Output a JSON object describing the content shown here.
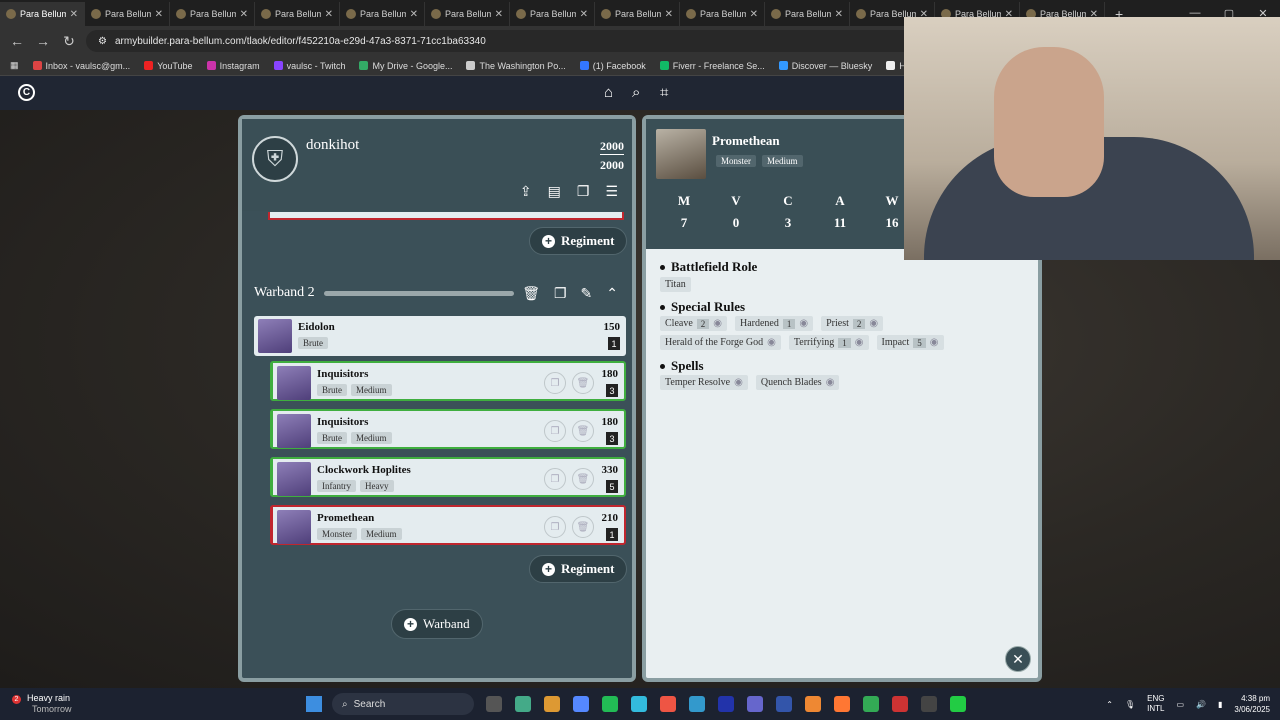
{
  "browser": {
    "tabs": [
      {
        "title": "Para Bellum",
        "active": true
      },
      {
        "title": "Para Bellum"
      },
      {
        "title": "Para Bellum"
      },
      {
        "title": "Para Bellum"
      },
      {
        "title": "Para Bellum"
      },
      {
        "title": "Para Bellum"
      },
      {
        "title": "Para Bellum"
      },
      {
        "title": "Para Bellum"
      },
      {
        "title": "Para Bellum"
      },
      {
        "title": "Para Bellum"
      },
      {
        "title": "Para Bellum"
      },
      {
        "title": "Para Bellum"
      },
      {
        "title": "Para Bellum"
      }
    ],
    "url": "armybuilder.para-bellum.com/tlaok/editor/f452210a-e29d-47a3-8371-71cc1ba63340",
    "bookmarks": [
      {
        "label": "Inbox - vaulsc@gm...",
        "color": "#d44"
      },
      {
        "label": "YouTube",
        "color": "#e22"
      },
      {
        "label": "Instagram",
        "color": "#c3a"
      },
      {
        "label": "vaulsc - Twitch",
        "color": "#84f"
      },
      {
        "label": "My Drive - Google...",
        "color": "#3a6"
      },
      {
        "label": "The Washington Po...",
        "color": "#ccc"
      },
      {
        "label": "(1) Facebook",
        "color": "#37f"
      },
      {
        "label": "Fiverr - Freelance Se...",
        "color": "#1b6"
      },
      {
        "label": "Discover — Bluesky",
        "color": "#39f"
      },
      {
        "label": "Home • Threads",
        "color": "#eee"
      }
    ]
  },
  "army": {
    "name": "donkihot",
    "points_used": "2000",
    "points_limit": "2000",
    "regiment_label": "Regiment",
    "warband_title": "Warband 2",
    "add_warband_label": "Warband",
    "units": [
      {
        "name": "Eidolon",
        "tags": [
          "Brute"
        ],
        "points": "150",
        "count": "1",
        "border": "none"
      },
      {
        "name": "Inquisitors",
        "tags": [
          "Brute",
          "Medium"
        ],
        "points": "180",
        "count": "3",
        "border": "green"
      },
      {
        "name": "Inquisitors",
        "tags": [
          "Brute",
          "Medium"
        ],
        "points": "180",
        "count": "3",
        "border": "green"
      },
      {
        "name": "Clockwork Hoplites",
        "tags": [
          "Infantry",
          "Heavy"
        ],
        "points": "330",
        "count": "5",
        "border": "green"
      },
      {
        "name": "Promethean",
        "tags": [
          "Monster",
          "Medium"
        ],
        "points": "210",
        "count": "1",
        "border": "red"
      }
    ]
  },
  "detail": {
    "name": "Promethean",
    "tags": [
      "Monster",
      "Medium"
    ],
    "stats": [
      {
        "label": "M",
        "value": "7"
      },
      {
        "label": "V",
        "value": "0"
      },
      {
        "label": "C",
        "value": "3"
      },
      {
        "label": "A",
        "value": "11"
      },
      {
        "label": "W",
        "value": "16"
      }
    ],
    "battlefield_role_title": "Battlefield Role",
    "battlefield_role": "Titan",
    "special_rules_title": "Special Rules",
    "special_rules_row1": [
      {
        "name": "Cleave",
        "level": "2"
      },
      {
        "name": "Hardened",
        "level": "1"
      },
      {
        "name": "Priest",
        "level": "2"
      }
    ],
    "special_rules_row2": [
      {
        "name": "Herald of the Forge God",
        "level": ""
      },
      {
        "name": "Terrifying",
        "level": "1"
      },
      {
        "name": "Impact",
        "level": "5"
      }
    ],
    "spells_title": "Spells",
    "spells": [
      "Temper Resolve",
      "Quench Blades"
    ]
  },
  "taskbar": {
    "weather_title": "Heavy rain",
    "weather_sub": "Tomorrow",
    "weather_badge": "2",
    "search_placeholder": "Search",
    "lang_top": "ENG",
    "lang_bottom": "INTL",
    "time": "4:38 pm",
    "date": "3/06/2025"
  }
}
